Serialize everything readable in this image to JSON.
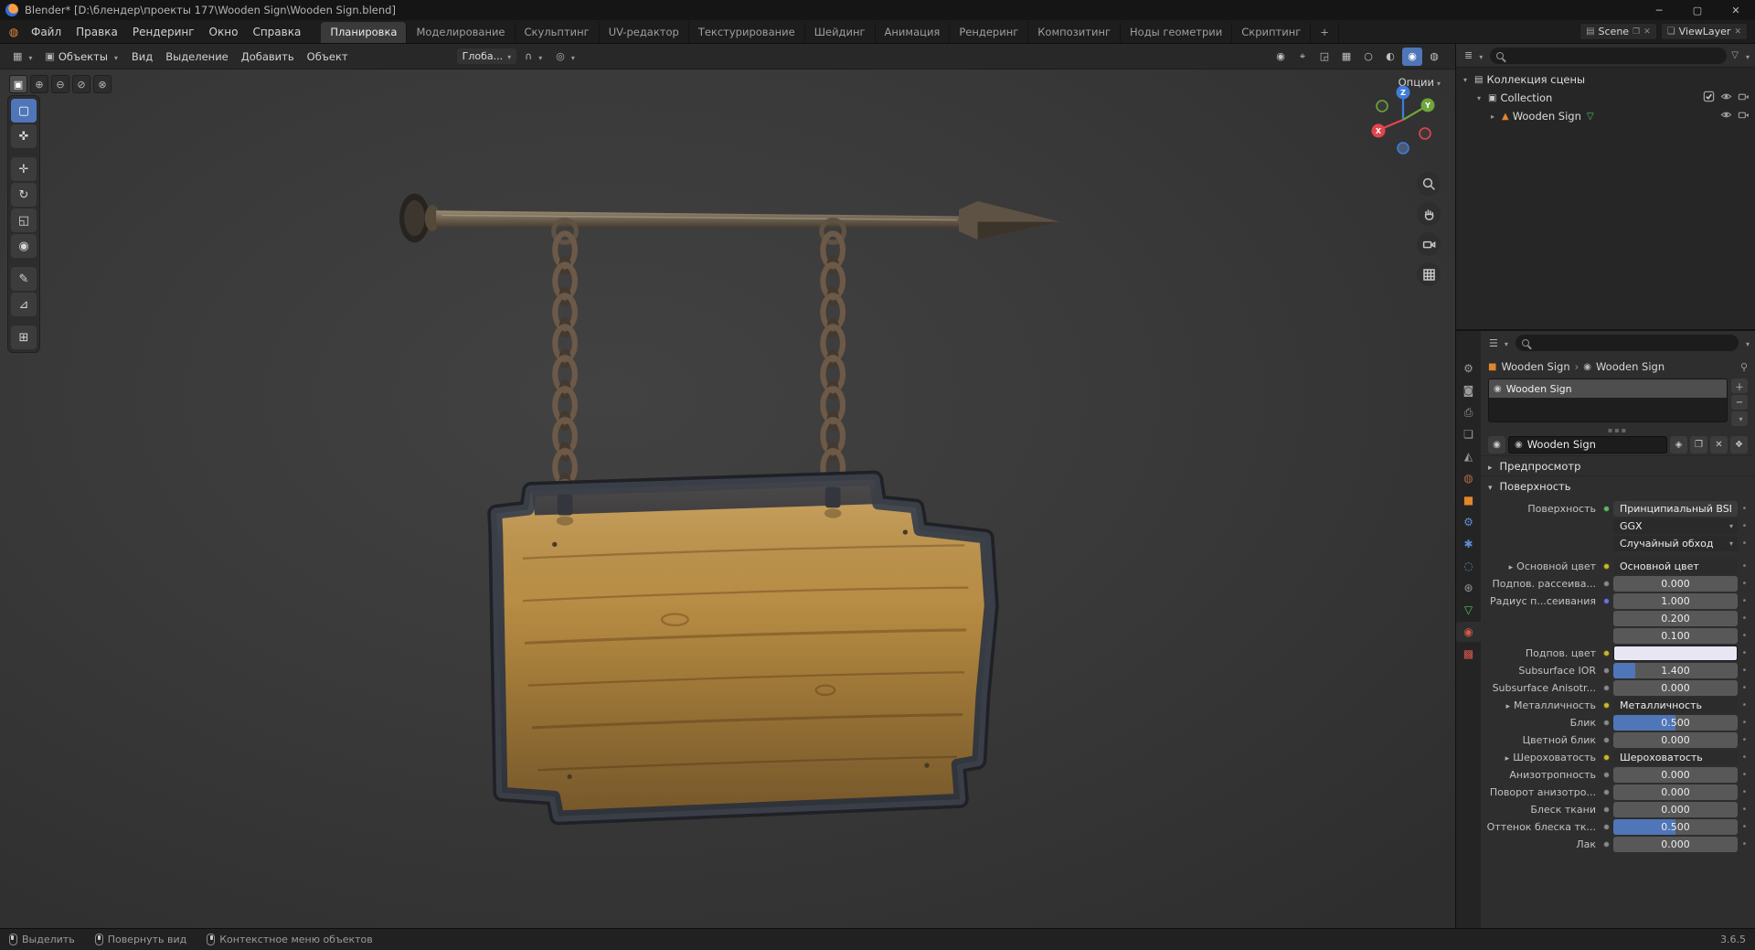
{
  "ui_colors": {
    "accent": "#4f76b8",
    "axis_x": "#e1464e",
    "axis_y": "#6fa53c",
    "axis_z": "#3f7ddc",
    "object_orange": "#e0862c",
    "data_green": "#4fc06a",
    "material_red": "#d6584a"
  },
  "titlebar": {
    "title": "Blender* [D:\\блендер\\проекты 177\\Wooden Sign\\Wooden Sign.blend]",
    "window_buttons": [
      {
        "name": "minimize-button",
        "glyph": "─"
      },
      {
        "name": "maximize-button",
        "glyph": "▢"
      },
      {
        "name": "close-button",
        "glyph": "✕"
      }
    ]
  },
  "topbar": {
    "menus": [
      "Файл",
      "Правка",
      "Рендеринг",
      "Окно",
      "Справка"
    ],
    "workspaces": [
      {
        "label": "Планировка",
        "active": true
      },
      {
        "label": "Моделирование"
      },
      {
        "label": "Скульптинг"
      },
      {
        "label": "UV-редактор"
      },
      {
        "label": "Текстурирование"
      },
      {
        "label": "Шейдинг"
      },
      {
        "label": "Анимация"
      },
      {
        "label": "Рендеринг"
      },
      {
        "label": "Композитинг"
      },
      {
        "label": "Ноды геометрии"
      },
      {
        "label": "Скриптинг"
      },
      {
        "label": "+"
      }
    ],
    "scene_label": "Scene",
    "view_layer_label": "ViewLayer"
  },
  "viewport_header": {
    "mode": "Объекты",
    "menus": [
      "Вид",
      "Выделение",
      "Добавить",
      "Объект"
    ],
    "orientation": "Глоба...",
    "snap_icon": "∩",
    "proportional_icon": "◎",
    "right_icons": [
      {
        "name": "visibility-dropdown",
        "glyph": "◉"
      },
      {
        "name": "gizmo-dropdown",
        "glyph": "⌖"
      },
      {
        "name": "overlays-dropdown",
        "glyph": "◲"
      },
      {
        "name": "xray-toggle",
        "glyph": "▦"
      },
      {
        "name": "shading-wireframe-button",
        "glyph": "○"
      },
      {
        "name": "shading-solid-button",
        "glyph": "◐"
      },
      {
        "name": "shading-material-button",
        "glyph": "◉",
        "active": true
      },
      {
        "name": "shading-rendered-button",
        "glyph": "◍"
      }
    ]
  },
  "viewport_overlays": {
    "options_label": "Опции"
  },
  "select_modes": [
    {
      "name": "select-mode-set",
      "glyph": "▣",
      "active": true
    },
    {
      "name": "select-mode-extend",
      "glyph": "⊕"
    },
    {
      "name": "select-mode-subtract",
      "glyph": "⊖"
    },
    {
      "name": "select-mode-invert",
      "glyph": "⊘"
    },
    {
      "name": "select-mode-intersect",
      "glyph": "⊗"
    }
  ],
  "tools": [
    {
      "name": "tool-select-box",
      "glyph": "▢",
      "active": true
    },
    {
      "name": "tool-cursor",
      "glyph": "✜"
    },
    {
      "name": "tool-move",
      "glyph": "✛",
      "group": true
    },
    {
      "name": "tool-rotate",
      "glyph": "↻"
    },
    {
      "name": "tool-scale",
      "glyph": "◱"
    },
    {
      "name": "tool-transform",
      "glyph": "◉"
    },
    {
      "name": "tool-annotate",
      "glyph": "✎",
      "group": true
    },
    {
      "name": "tool-measure",
      "glyph": "⊿"
    },
    {
      "name": "tool-add-cube",
      "glyph": "⊞",
      "group": true
    }
  ],
  "outliner": {
    "rows": [
      {
        "label": "Коллекция сцены",
        "icon": "▤",
        "icon_color": "#c8c8c8",
        "arrow": "▾",
        "level": 0,
        "toggles": []
      },
      {
        "label": "Collection",
        "icon": "▣",
        "icon_color": "#c8c8c8",
        "arrow": "▾",
        "level": 1,
        "toggles": [
          "checkbox",
          "eye",
          "camera"
        ]
      },
      {
        "label": "Wooden Sign",
        "icon": "▲",
        "icon_color": "#e0862c",
        "arrow": "▸",
        "level": 2,
        "extra_icon": "▽",
        "extra_color": "#4fc06a",
        "toggles": [
          "eye",
          "camera"
        ]
      }
    ]
  },
  "properties": {
    "tabs": [
      {
        "name": "tab-tool",
        "glyph": "⚙",
        "color": "#9a9a9a"
      },
      {
        "name": "tab-render",
        "glyph": "◙",
        "color": "#9a9a9a"
      },
      {
        "name": "tab-output",
        "glyph": "⎙",
        "color": "#9a9a9a"
      },
      {
        "name": "tab-view-layer",
        "glyph": "❏",
        "color": "#9a9a9a"
      },
      {
        "name": "tab-scene",
        "glyph": "◭",
        "color": "#9a9a9a"
      },
      {
        "name": "tab-world",
        "glyph": "◍",
        "color": "#b06a4a"
      },
      {
        "name": "tab-object",
        "glyph": "■",
        "color": "#e0862c"
      },
      {
        "name": "tab-modifiers",
        "glyph": "⚙",
        "color": "#5a8fd4"
      },
      {
        "name": "tab-particles",
        "glyph": "✱",
        "color": "#5a8fd4"
      },
      {
        "name": "tab-physics",
        "glyph": "◌",
        "color": "#5a8fd4"
      },
      {
        "name": "tab-constraints",
        "glyph": "⊛",
        "color": "#9a9a9a"
      },
      {
        "name": "tab-object-data",
        "glyph": "▽",
        "color": "#4fc06a"
      },
      {
        "name": "tab-material",
        "glyph": "◉",
        "color": "#d6584a",
        "active": true
      },
      {
        "name": "tab-texture",
        "glyph": "▩",
        "color": "#d6584a"
      }
    ],
    "breadcrumb": {
      "object": "Wooden Sign",
      "separator": "›",
      "material": "Wooden Sign"
    },
    "slot_name": "Wooden Sign",
    "material_name": "Wooden Sign",
    "panel_preview": "Предпросмотр",
    "panel_surface": "Поверхность",
    "rows": [
      {
        "label": "Поверхность",
        "type": "menu",
        "value": "Принципиальный BSDF",
        "socket": "#63b56a"
      },
      {
        "label": "",
        "type": "dropdown",
        "value": "GGX"
      },
      {
        "label": "",
        "type": "dropdown",
        "value": "Случайный обход"
      },
      {
        "label": "Основной цвет",
        "type": "link",
        "value": "Основной цвет",
        "socket": "#c9b932",
        "expand": true,
        "gap": true
      },
      {
        "label": "Подпов. рассеива...",
        "type": "slider",
        "value": "0.000",
        "fill": 0,
        "socket": "#8a8a8a"
      },
      {
        "label": "Радиус п...сеивания",
        "type": "value",
        "value": "1.000",
        "socket": "#6974d8"
      },
      {
        "label": "",
        "type": "value",
        "value": "0.200"
      },
      {
        "label": "",
        "type": "value",
        "value": "0.100"
      },
      {
        "label": "Подпов. цвет",
        "type": "color",
        "value": "#e9e6f4",
        "socket": "#c9b932"
      },
      {
        "label": "Subsurface IOR",
        "type": "slider",
        "value": "1.400",
        "fill": 0.18,
        "socket": "#8a8a8a"
      },
      {
        "label": "Subsurface Anisotr...",
        "type": "slider",
        "value": "0.000",
        "fill": 0,
        "socket": "#8a8a8a"
      },
      {
        "label": "Металличность",
        "type": "link",
        "value": "Металличность",
        "socket": "#c9b932",
        "expand": true
      },
      {
        "label": "Блик",
        "type": "slider",
        "value": "0.500",
        "fill": 0.5,
        "socket": "#8a8a8a"
      },
      {
        "label": "Цветной блик",
        "type": "slider",
        "value": "0.000",
        "fill": 0,
        "socket": "#8a8a8a"
      },
      {
        "label": "Шероховатость",
        "type": "link",
        "value": "Шероховатость",
        "socket": "#c9b932",
        "expand": true
      },
      {
        "label": "Анизотропность",
        "type": "slider",
        "value": "0.000",
        "fill": 0,
        "socket": "#8a8a8a"
      },
      {
        "label": "Поворот анизотро...",
        "type": "slider",
        "value": "0.000",
        "fill": 0,
        "socket": "#8a8a8a"
      },
      {
        "label": "Блеск ткани",
        "type": "slider",
        "value": "0.000",
        "fill": 0,
        "socket": "#8a8a8a"
      },
      {
        "label": "Оттенок блеска тк...",
        "type": "slider",
        "value": "0.500",
        "fill": 0.5,
        "socket": "#8a8a8a"
      },
      {
        "label": "Лак",
        "type": "slider",
        "value": "0.000",
        "fill": 0,
        "socket": "#8a8a8a"
      }
    ]
  },
  "statusbar": {
    "hints": [
      {
        "button": "left",
        "label": "Выделить"
      },
      {
        "button": "middle",
        "label": "Повернуть вид"
      },
      {
        "button": "right",
        "label": "Контекстное меню объектов"
      }
    ],
    "version": "3.6.5"
  }
}
